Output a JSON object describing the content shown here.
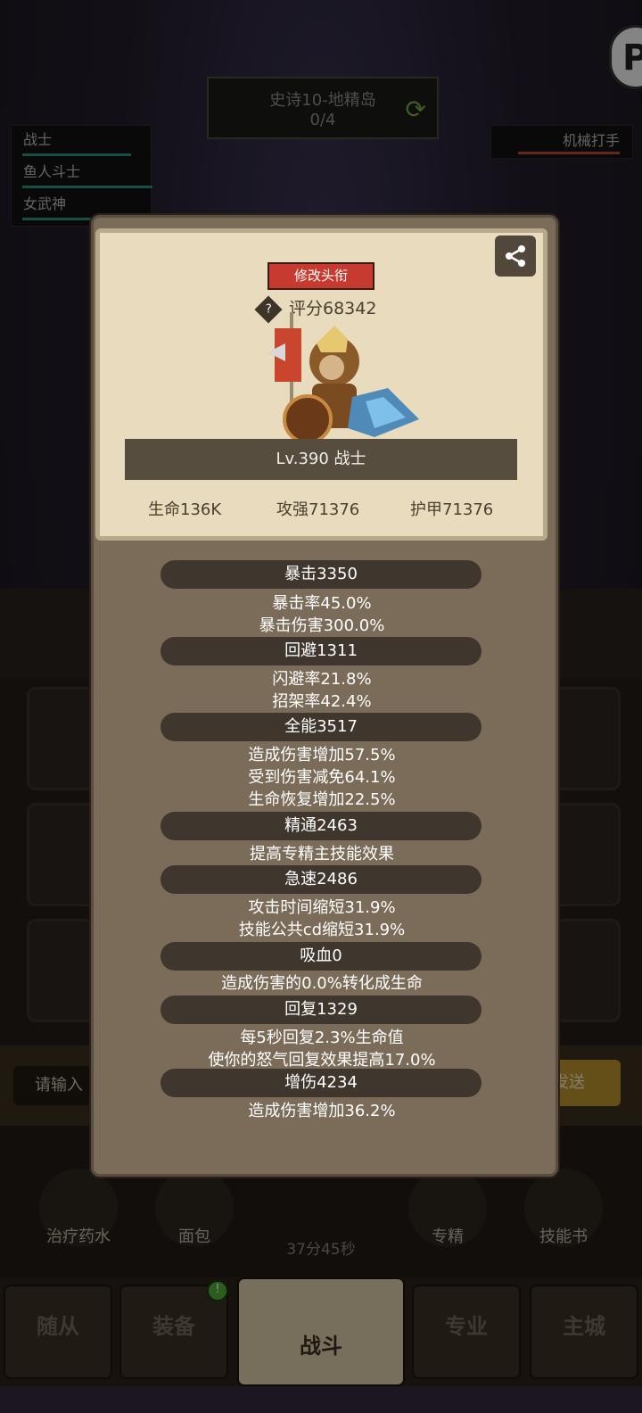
{
  "stage": {
    "name": "史诗10-地精岛",
    "progress": "0/4"
  },
  "team": [
    "战士",
    "鱼人斗士",
    "女武神"
  ],
  "enemy": "机械打手",
  "profile": {
    "title_button": "修改头衔",
    "score_icon": "?",
    "score": "评分68342",
    "level_class": "Lv.390 战士",
    "hp": "生命136K",
    "attack": "攻强71376",
    "armor": "护甲71376"
  },
  "sections": [
    {
      "header": "暴击3350",
      "lines": [
        "暴击率45.0%",
        "暴击伤害300.0%"
      ]
    },
    {
      "header": "回避1311",
      "lines": [
        "闪避率21.8%",
        "招架率42.4%"
      ]
    },
    {
      "header": "全能3517",
      "lines": [
        "造成伤害增加57.5%",
        "受到伤害减免64.1%",
        "生命恢复增加22.5%"
      ]
    },
    {
      "header": "精通2463",
      "lines": [
        "提高专精主技能效果"
      ]
    },
    {
      "header": "急速2486",
      "lines": [
        "攻击时间缩短31.9%",
        "技能公共cd缩短31.9%"
      ]
    },
    {
      "header": "吸血0",
      "lines": [
        "造成伤害的0.0%转化成生命"
      ]
    },
    {
      "header": "回复1329",
      "lines": [
        "每5秒回复2.3%生命值",
        "使你的怒气回复效果提高17.0%"
      ]
    },
    {
      "header": "增伤4234",
      "lines": [
        "造成伤害增加36.2%"
      ]
    }
  ],
  "chat": {
    "placeholder": "请输入",
    "send": "发送"
  },
  "items": [
    "治疗药水",
    "面包",
    "专精",
    "技能书"
  ],
  "timer": "37分45秒",
  "tabs": [
    "随从",
    "装备",
    "战斗",
    "专业",
    "主城"
  ],
  "badge": "!",
  "colors": {
    "title_button": "#c73a30",
    "card": "#e9dbbd",
    "modal": "#7b6c59",
    "section_header": "#3f362d"
  }
}
